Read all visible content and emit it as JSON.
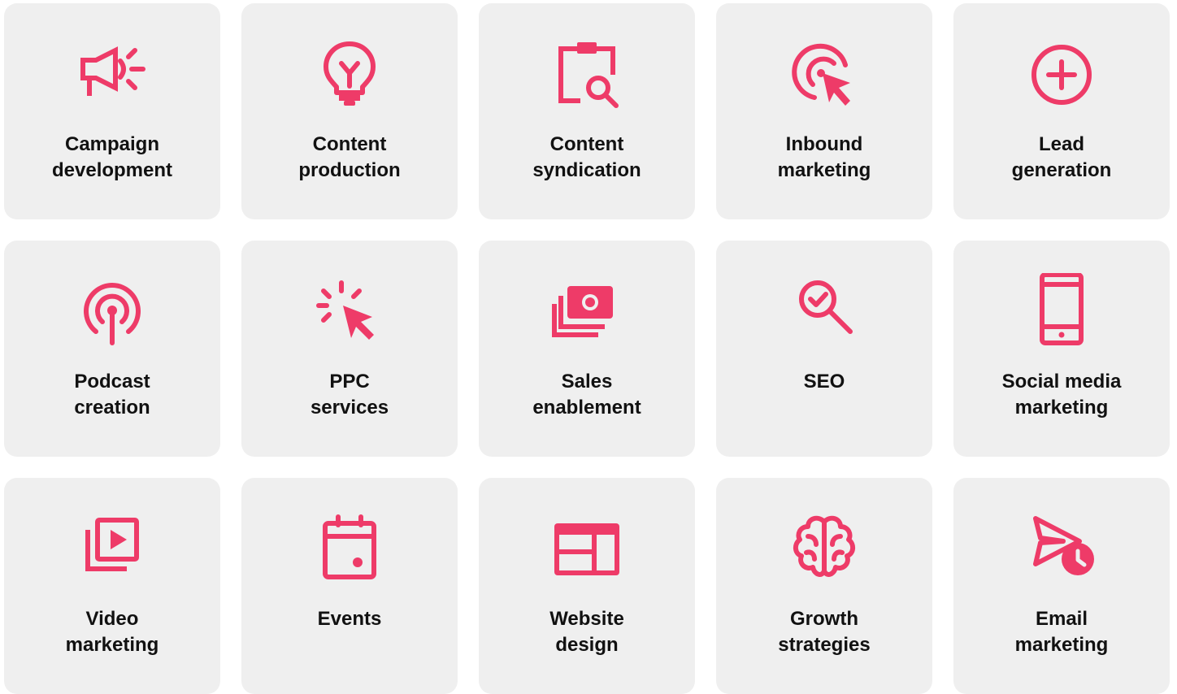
{
  "colors": {
    "accent": "#ee3b68",
    "card_background": "#efefef",
    "text": "#111111"
  },
  "services": [
    {
      "line1": "Campaign",
      "line2": "development",
      "icon": "megaphone-icon"
    },
    {
      "line1": "Content",
      "line2": "production",
      "icon": "lightbulb-icon"
    },
    {
      "line1": "Content",
      "line2": "syndication",
      "icon": "clipboard-search-icon"
    },
    {
      "line1": "Inbound",
      "line2": "marketing",
      "icon": "target-cursor-icon"
    },
    {
      "line1": "Lead",
      "line2": "generation",
      "icon": "plus-circle-icon"
    },
    {
      "line1": "Podcast",
      "line2": "creation",
      "icon": "podcast-icon"
    },
    {
      "line1": "PPC",
      "line2": "services",
      "icon": "click-cursor-icon"
    },
    {
      "line1": "Sales",
      "line2": "enablement",
      "icon": "money-stack-icon"
    },
    {
      "line1": "SEO",
      "line2": "",
      "icon": "magnifier-check-icon"
    },
    {
      "line1": "Social media",
      "line2": "marketing",
      "icon": "smartphone-icon"
    },
    {
      "line1": "Video",
      "line2": "marketing",
      "icon": "video-library-icon"
    },
    {
      "line1": "Events",
      "line2": "",
      "icon": "calendar-icon"
    },
    {
      "line1": "Website",
      "line2": "design",
      "icon": "web-layout-icon"
    },
    {
      "line1": "Growth",
      "line2": "strategies",
      "icon": "brain-icon"
    },
    {
      "line1": "Email",
      "line2": "marketing",
      "icon": "send-clock-icon"
    }
  ]
}
